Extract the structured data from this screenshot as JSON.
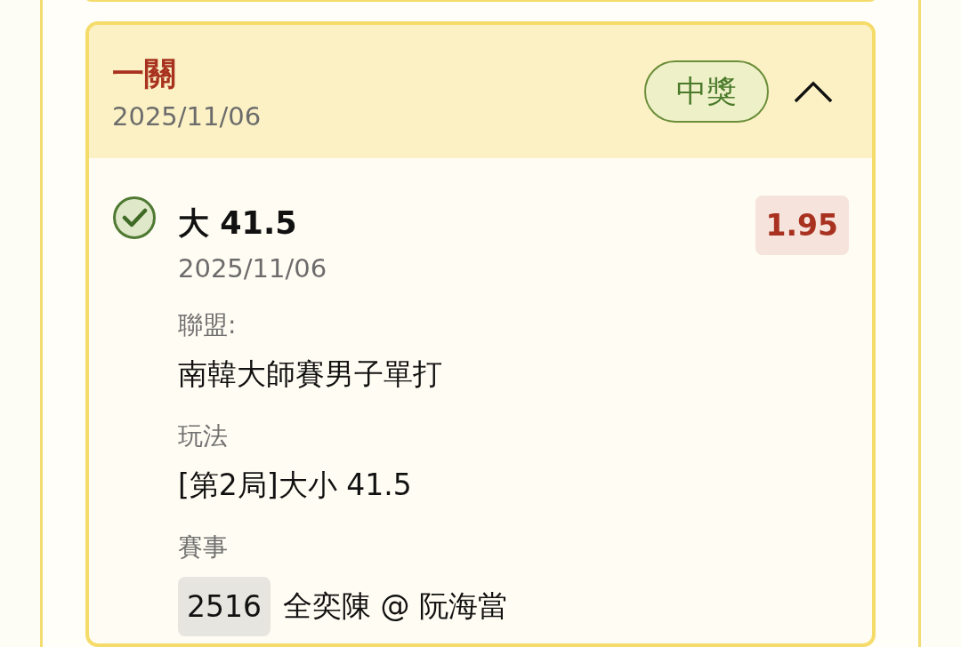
{
  "bet": {
    "title": "一關",
    "date": "2025/11/06",
    "status": {
      "label": "中獎",
      "kind": "won"
    },
    "expanded": true,
    "legs": [
      {
        "won": true,
        "selection": "大 41.5",
        "date": "2025/11/06",
        "odds": "1.95",
        "fields": [
          {
            "label": "聯盟:",
            "value": "南韓大師賽男子單打"
          },
          {
            "label": "玩法",
            "value": "[第2局]大小 41.5"
          },
          {
            "label": "賽事",
            "match_id": "2516",
            "value": "全奕陳 @ 阮海當"
          }
        ]
      }
    ]
  }
}
